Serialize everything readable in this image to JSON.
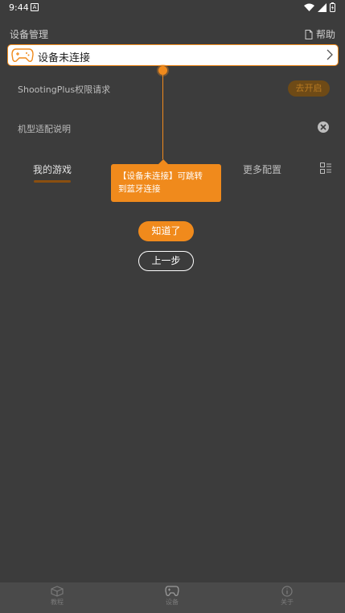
{
  "status_bar": {
    "time": "9:44",
    "notif_letter": "A"
  },
  "header": {
    "title": "设备管理",
    "help_label": "帮助"
  },
  "device": {
    "label": "设备未连接"
  },
  "permission": {
    "label": "ShootingPlus权限请求",
    "button": "去开启"
  },
  "adapt": {
    "label": "机型适配说明"
  },
  "tabs": {
    "my_games": "我的游戏",
    "more_config": "更多配置"
  },
  "guide": {
    "tip_line1": "【设备未连接】可跳转",
    "tip_line2": "到蓝牙连接",
    "ok_button": "知道了",
    "prev_button": "上一步"
  },
  "bottom_nav": [
    {
      "label": "教程"
    },
    {
      "label": "设备"
    },
    {
      "label": "关于"
    }
  ],
  "colors": {
    "accent": "#f08a1c",
    "background": "#3c3c3c"
  }
}
